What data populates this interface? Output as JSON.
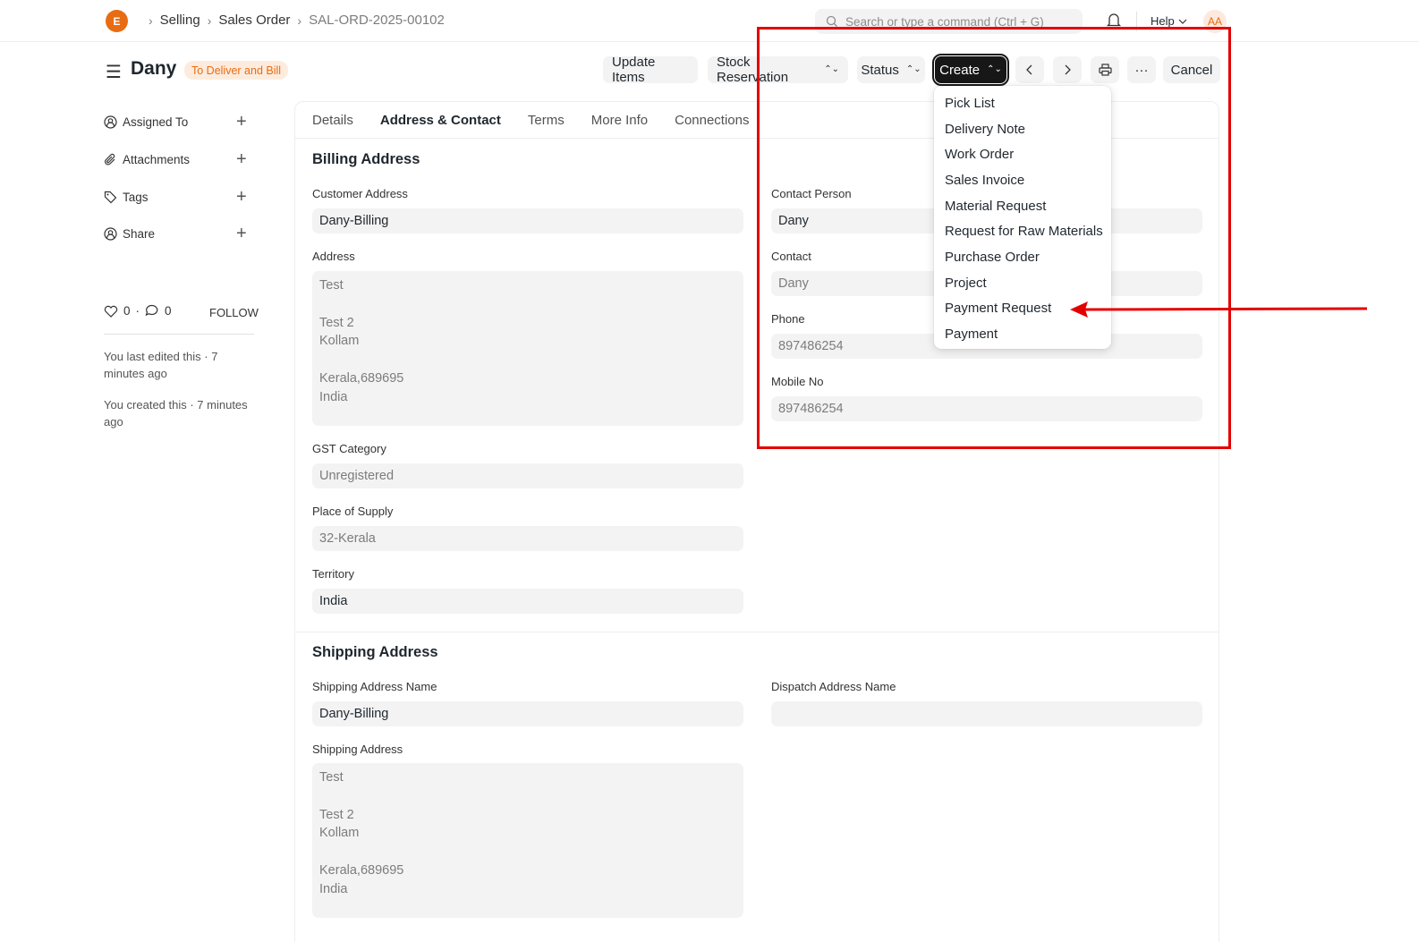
{
  "navbar": {
    "logo_text": "E",
    "breadcrumbs": [
      "Selling",
      "Sales Order",
      "SAL-ORD-2025-00102"
    ],
    "search_placeholder": "Search or type a command (Ctrl + G)",
    "help_label": "Help",
    "avatar_initials": "AA"
  },
  "header": {
    "title": "Dany",
    "status": "To Deliver and Bill",
    "buttons": {
      "update_items": "Update Items",
      "stock_reservation": "Stock Reservation",
      "status": "Status",
      "create": "Create",
      "more": "···",
      "cancel": "Cancel"
    }
  },
  "sidebar": {
    "items": [
      {
        "label": "Assigned To"
      },
      {
        "label": "Attachments"
      },
      {
        "label": "Tags"
      },
      {
        "label": "Share"
      }
    ],
    "likes": "0",
    "comments": "0",
    "follow": "FOLLOW",
    "last_edited": "You last edited this · 7 minutes ago",
    "created": "You created this · 7 minutes ago"
  },
  "tabs": [
    "Details",
    "Address & Contact",
    "Terms",
    "More Info",
    "Connections"
  ],
  "billing": {
    "title": "Billing Address",
    "customer_address_label": "Customer Address",
    "customer_address": "Dany-Billing",
    "address_label": "Address",
    "address": "Test\n\nTest 2\nKollam\n\nKerala,689695\nIndia",
    "gst_label": "GST Category",
    "gst": "Unregistered",
    "place_label": "Place of Supply",
    "place": "32-Kerala",
    "territory_label": "Territory",
    "territory": "India",
    "contact_person_label": "Contact Person",
    "contact_person": "Dany",
    "contact_label": "Contact",
    "contact": "Dany",
    "phone_label": "Phone",
    "phone": "897486254",
    "mobile_label": "Mobile No",
    "mobile": "897486254"
  },
  "shipping": {
    "title": "Shipping Address",
    "name_label": "Shipping Address Name",
    "name": "Dany-Billing",
    "dispatch_label": "Dispatch Address Name",
    "dispatch": "",
    "address_label": "Shipping Address",
    "address": "Test\n\nTest 2\nKollam\n\nKerala,689695\nIndia"
  },
  "create_menu": [
    "Pick List",
    "Delivery Note",
    "Work Order",
    "Sales Invoice",
    "Material Request",
    "Request for Raw Materials",
    "Purchase Order",
    "Project",
    "Payment Request",
    "Payment"
  ],
  "colors": {
    "brand": "#e86c13",
    "annotation": "#e50000"
  }
}
